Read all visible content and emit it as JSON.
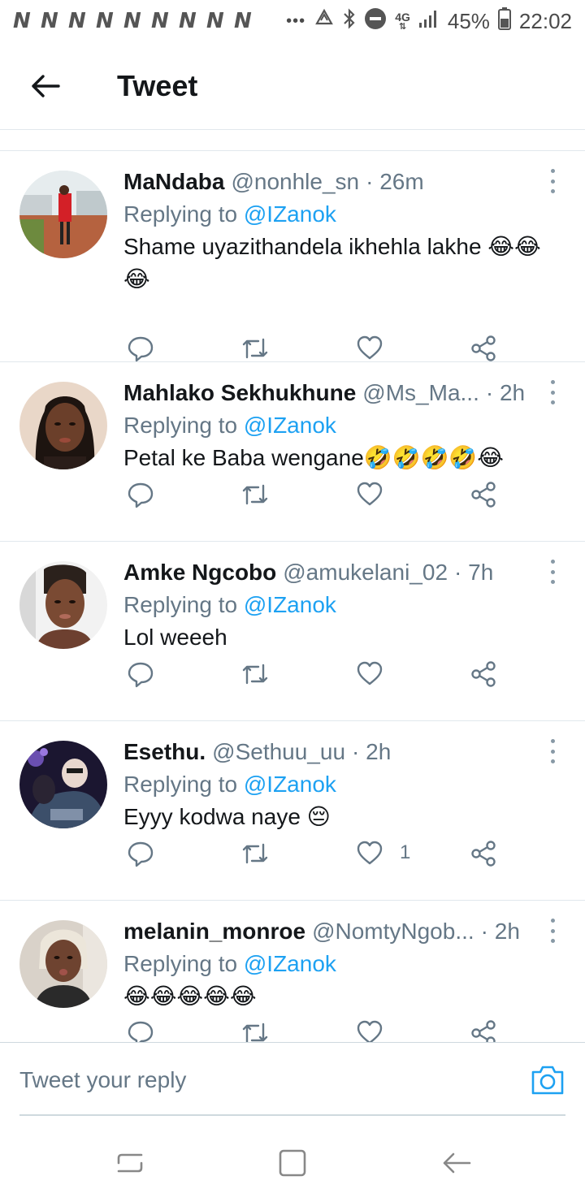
{
  "status_bar": {
    "notification_letters": [
      "N",
      "N",
      "N",
      "N",
      "N",
      "N",
      "N",
      "N",
      "N"
    ],
    "more_dots": "•••",
    "network_label": "4G",
    "battery_percent": "45%",
    "clock": "22:02"
  },
  "header": {
    "title": "Tweet"
  },
  "tweets": [
    {
      "name": "MaNdaba",
      "handle": "@nonhle_sn",
      "time": "· 26m",
      "replying_prefix": "Replying to ",
      "replying_to": "@IZanok",
      "text": "Shame uyazithandela ikhehla lakhe 😂😂😂",
      "like_count": ""
    },
    {
      "name": "Mahlako Sekhukhune",
      "handle": "@Ms_Ma...",
      "time": "· 2h",
      "replying_prefix": "Replying to ",
      "replying_to": "@IZanok",
      "text": "Petal ke Baba wengane🤣🤣🤣🤣😂",
      "like_count": ""
    },
    {
      "name": "Amke Ngcobo",
      "handle": "@amukelani_02",
      "time": "· 7h",
      "replying_prefix": "Replying to ",
      "replying_to": "@IZanok",
      "text": "Lol weeeh",
      "like_count": ""
    },
    {
      "name": "Esethu.",
      "handle": "@Sethuu_uu",
      "time": "· 2h",
      "replying_prefix": "Replying to ",
      "replying_to": "@IZanok",
      "text": "Eyyy kodwa naye 😔",
      "like_count": "1"
    },
    {
      "name": "melanin_monroe",
      "handle": "@NomtyNgob...",
      "time": "· 2h",
      "replying_prefix": "Replying to ",
      "replying_to": "@IZanok",
      "text": "😂😂😂😂😂",
      "like_count": ""
    }
  ],
  "composer": {
    "placeholder": "Tweet your reply"
  },
  "colors": {
    "accent": "#1da1f2",
    "text_primary": "#14171a",
    "text_secondary": "#657786",
    "divider": "#e1e8ed"
  },
  "icons": {
    "back": "arrow-left-icon",
    "reply": "speech-bubble-icon",
    "retweet": "retweet-arrows-icon",
    "like": "heart-icon",
    "share": "share-nodes-icon",
    "more": "vertical-dots-icon",
    "camera": "camera-icon"
  }
}
